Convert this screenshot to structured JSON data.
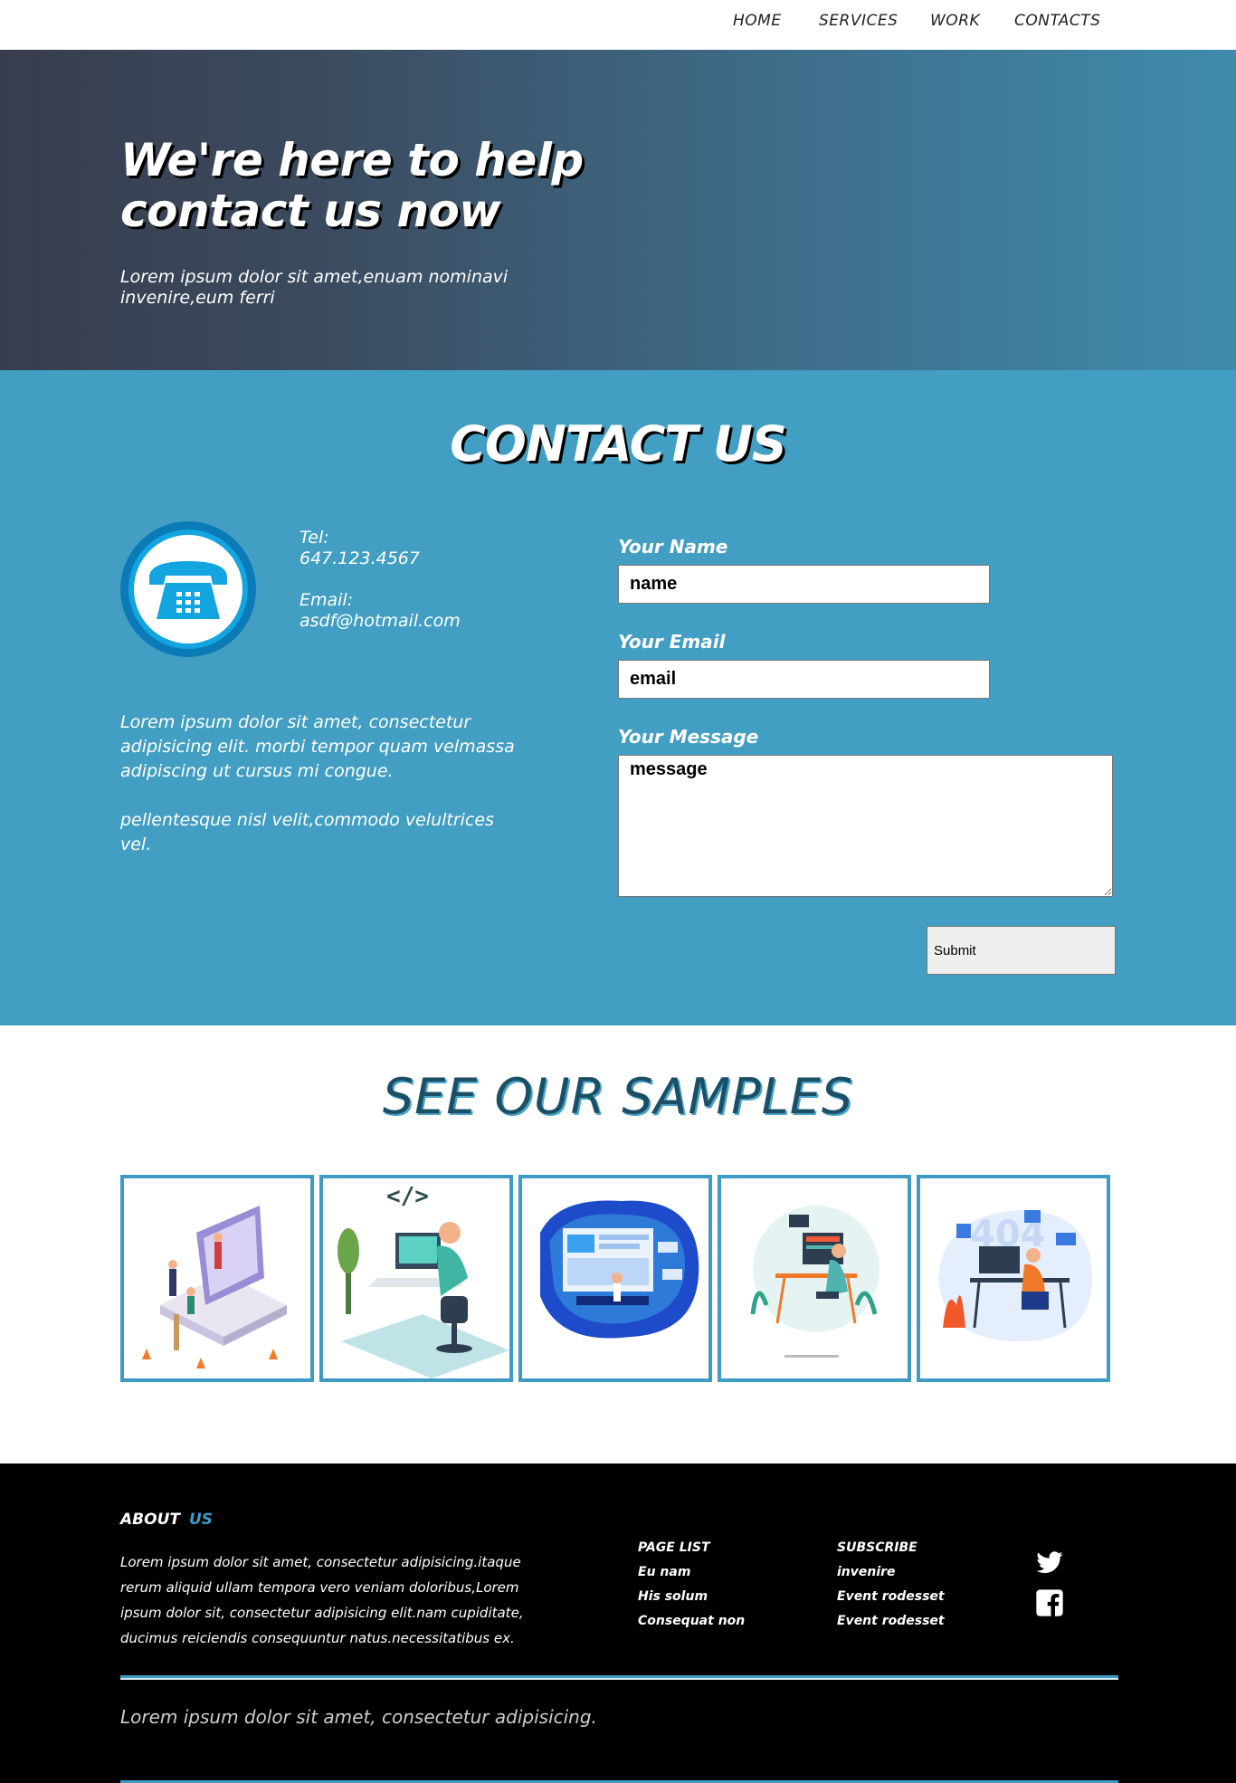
{
  "nav": {
    "items": [
      "HOME",
      "SERVICES",
      "WORK",
      "CONTACTS"
    ]
  },
  "hero": {
    "title_line1": "We're here to help",
    "title_line2": "contact us now",
    "subtitle": "Lorem ipsum dolor sit amet,enuam nominavi invenire,eum ferri"
  },
  "contact": {
    "heading": "CONTACT US",
    "tel_label": "Tel:",
    "tel_value": "647.123.4567",
    "email_label": "Email:",
    "email_value": "asdf@hotmail.com",
    "para1": "Lorem ipsum dolor sit amet, consectetur adipisicing elit. morbi tempor quam velmassa adipiscing ut cursus mi congue.",
    "para2": "pellentesque nisl velit,commodo velultrices vel.",
    "form": {
      "name_label": "Your Name",
      "name_value": "name",
      "email_label": "Your Email",
      "email_value": "email",
      "message_label": "Your Message",
      "message_value": "message",
      "submit_label": "Submit"
    }
  },
  "samples": {
    "heading": "SEE OUR SAMPLES"
  },
  "footer": {
    "about_title": "ABOUT",
    "about_title_accent": "US",
    "about_text": "Lorem ipsum dolor sit amet, consectetur adipisicing.itaque rerum aliquid ullam tempora vero veniam doloribus,Lorem ipsum dolor sit, consectetur adipisicing elit.nam cupiditate, ducimus reiciendis consequuntur natus.necessitatibus ex.",
    "page_list_title": "PAGE LIST",
    "page_list": [
      "Eu nam",
      "His solum",
      "Consequat non"
    ],
    "subscribe_title": "SUBSCRIBE",
    "subscribe": [
      "invenire",
      "Event rodesset",
      "Event rodesset"
    ],
    "bottom_text": "Lorem ipsum dolor sit amet, consectetur adipisicing."
  }
}
